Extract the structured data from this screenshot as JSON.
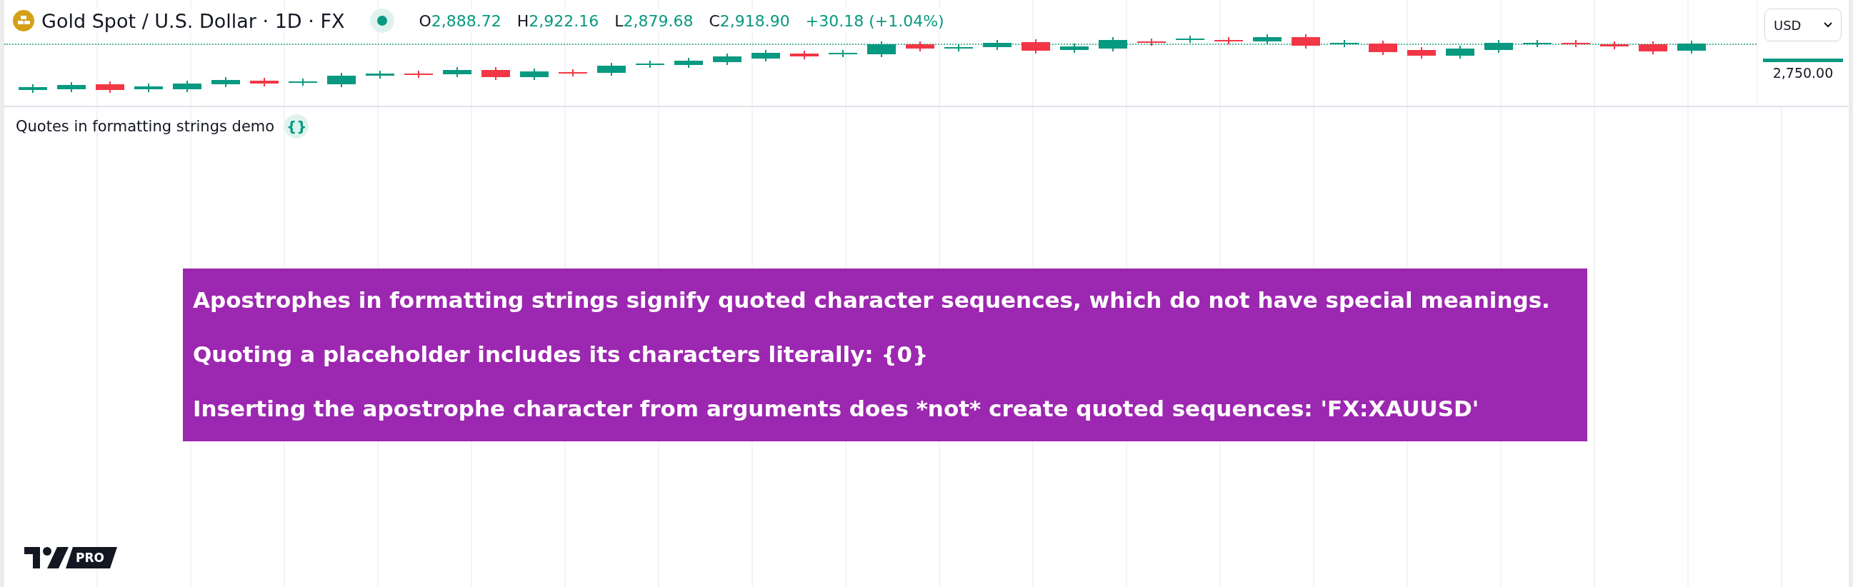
{
  "header": {
    "symbol_title": "Gold Spot / U.S. Dollar · 1D · FX",
    "market_open": true,
    "ohlc": [
      {
        "label": "O",
        "value": "2,888.72"
      },
      {
        "label": "H",
        "value": "2,922.16"
      },
      {
        "label": "L",
        "value": "2,879.68"
      },
      {
        "label": "C",
        "value": "2,918.90"
      }
    ],
    "change": "+30.18 (+1.04%)"
  },
  "currency_select": {
    "value": "USD"
  },
  "price_scale": {
    "label": "2,750.00"
  },
  "indicator": {
    "title": "Quotes in formatting strings demo",
    "source_icon": "{}"
  },
  "table": {
    "rows": [
      "Apostrophes in formatting strings signify quoted character sequences, which do not have special meanings.",
      "Quoting a placeholder includes its characters literally: {0}",
      "Inserting the apostrophe character from arguments does *not* create quoted sequences: 'FX:XAUUSD'"
    ]
  },
  "logo": {
    "badge": "PRO"
  }
}
